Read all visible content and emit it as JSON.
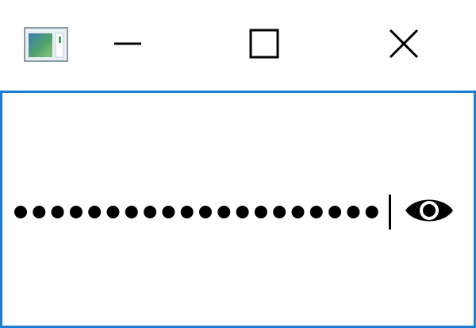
{
  "window": {
    "buttons": [
      {
        "name": "minimize",
        "icon": "minimize-icon"
      },
      {
        "name": "maximize",
        "icon": "maximize-icon"
      },
      {
        "name": "close",
        "icon": "close-icon"
      }
    ],
    "app_icon": "app-window-icon",
    "accent_color": "#1a7fd4"
  },
  "password_field": {
    "masked_character_count": 20,
    "mask_color": "#000000",
    "caret_visible": true,
    "reveal_button_icon": "eye-icon"
  }
}
